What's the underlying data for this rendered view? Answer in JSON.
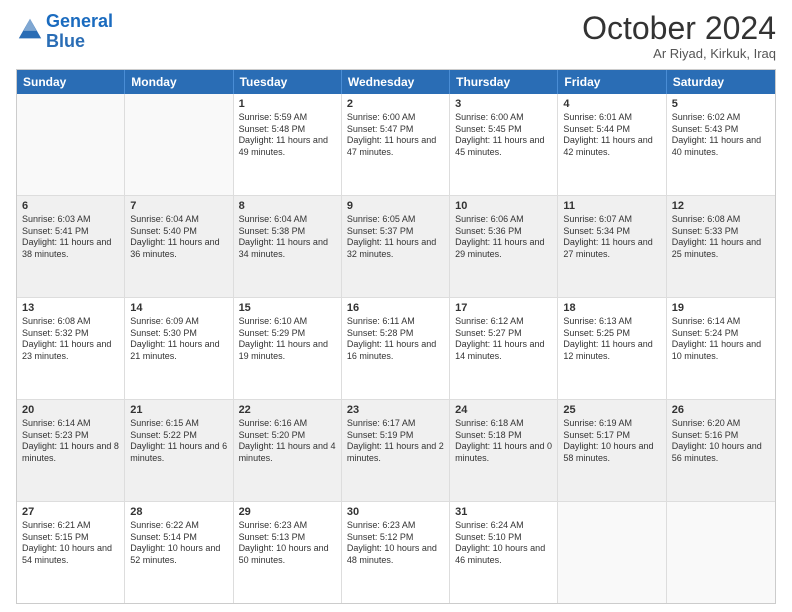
{
  "header": {
    "logo_general": "General",
    "logo_blue": "Blue",
    "month_year": "October 2024",
    "location": "Ar Riyad, Kirkuk, Iraq"
  },
  "days_of_week": [
    "Sunday",
    "Monday",
    "Tuesday",
    "Wednesday",
    "Thursday",
    "Friday",
    "Saturday"
  ],
  "weeks": [
    [
      {
        "day": "",
        "sunrise": "",
        "sunset": "",
        "daylight": "",
        "shaded": false
      },
      {
        "day": "",
        "sunrise": "",
        "sunset": "",
        "daylight": "",
        "shaded": false
      },
      {
        "day": "1",
        "sunrise": "Sunrise: 5:59 AM",
        "sunset": "Sunset: 5:48 PM",
        "daylight": "Daylight: 11 hours and 49 minutes.",
        "shaded": false
      },
      {
        "day": "2",
        "sunrise": "Sunrise: 6:00 AM",
        "sunset": "Sunset: 5:47 PM",
        "daylight": "Daylight: 11 hours and 47 minutes.",
        "shaded": false
      },
      {
        "day": "3",
        "sunrise": "Sunrise: 6:00 AM",
        "sunset": "Sunset: 5:45 PM",
        "daylight": "Daylight: 11 hours and 45 minutes.",
        "shaded": false
      },
      {
        "day": "4",
        "sunrise": "Sunrise: 6:01 AM",
        "sunset": "Sunset: 5:44 PM",
        "daylight": "Daylight: 11 hours and 42 minutes.",
        "shaded": false
      },
      {
        "day": "5",
        "sunrise": "Sunrise: 6:02 AM",
        "sunset": "Sunset: 5:43 PM",
        "daylight": "Daylight: 11 hours and 40 minutes.",
        "shaded": false
      }
    ],
    [
      {
        "day": "6",
        "sunrise": "Sunrise: 6:03 AM",
        "sunset": "Sunset: 5:41 PM",
        "daylight": "Daylight: 11 hours and 38 minutes.",
        "shaded": true
      },
      {
        "day": "7",
        "sunrise": "Sunrise: 6:04 AM",
        "sunset": "Sunset: 5:40 PM",
        "daylight": "Daylight: 11 hours and 36 minutes.",
        "shaded": true
      },
      {
        "day": "8",
        "sunrise": "Sunrise: 6:04 AM",
        "sunset": "Sunset: 5:38 PM",
        "daylight": "Daylight: 11 hours and 34 minutes.",
        "shaded": true
      },
      {
        "day": "9",
        "sunrise": "Sunrise: 6:05 AM",
        "sunset": "Sunset: 5:37 PM",
        "daylight": "Daylight: 11 hours and 32 minutes.",
        "shaded": true
      },
      {
        "day": "10",
        "sunrise": "Sunrise: 6:06 AM",
        "sunset": "Sunset: 5:36 PM",
        "daylight": "Daylight: 11 hours and 29 minutes.",
        "shaded": true
      },
      {
        "day": "11",
        "sunrise": "Sunrise: 6:07 AM",
        "sunset": "Sunset: 5:34 PM",
        "daylight": "Daylight: 11 hours and 27 minutes.",
        "shaded": true
      },
      {
        "day": "12",
        "sunrise": "Sunrise: 6:08 AM",
        "sunset": "Sunset: 5:33 PM",
        "daylight": "Daylight: 11 hours and 25 minutes.",
        "shaded": true
      }
    ],
    [
      {
        "day": "13",
        "sunrise": "Sunrise: 6:08 AM",
        "sunset": "Sunset: 5:32 PM",
        "daylight": "Daylight: 11 hours and 23 minutes.",
        "shaded": false
      },
      {
        "day": "14",
        "sunrise": "Sunrise: 6:09 AM",
        "sunset": "Sunset: 5:30 PM",
        "daylight": "Daylight: 11 hours and 21 minutes.",
        "shaded": false
      },
      {
        "day": "15",
        "sunrise": "Sunrise: 6:10 AM",
        "sunset": "Sunset: 5:29 PM",
        "daylight": "Daylight: 11 hours and 19 minutes.",
        "shaded": false
      },
      {
        "day": "16",
        "sunrise": "Sunrise: 6:11 AM",
        "sunset": "Sunset: 5:28 PM",
        "daylight": "Daylight: 11 hours and 16 minutes.",
        "shaded": false
      },
      {
        "day": "17",
        "sunrise": "Sunrise: 6:12 AM",
        "sunset": "Sunset: 5:27 PM",
        "daylight": "Daylight: 11 hours and 14 minutes.",
        "shaded": false
      },
      {
        "day": "18",
        "sunrise": "Sunrise: 6:13 AM",
        "sunset": "Sunset: 5:25 PM",
        "daylight": "Daylight: 11 hours and 12 minutes.",
        "shaded": false
      },
      {
        "day": "19",
        "sunrise": "Sunrise: 6:14 AM",
        "sunset": "Sunset: 5:24 PM",
        "daylight": "Daylight: 11 hours and 10 minutes.",
        "shaded": false
      }
    ],
    [
      {
        "day": "20",
        "sunrise": "Sunrise: 6:14 AM",
        "sunset": "Sunset: 5:23 PM",
        "daylight": "Daylight: 11 hours and 8 minutes.",
        "shaded": true
      },
      {
        "day": "21",
        "sunrise": "Sunrise: 6:15 AM",
        "sunset": "Sunset: 5:22 PM",
        "daylight": "Daylight: 11 hours and 6 minutes.",
        "shaded": true
      },
      {
        "day": "22",
        "sunrise": "Sunrise: 6:16 AM",
        "sunset": "Sunset: 5:20 PM",
        "daylight": "Daylight: 11 hours and 4 minutes.",
        "shaded": true
      },
      {
        "day": "23",
        "sunrise": "Sunrise: 6:17 AM",
        "sunset": "Sunset: 5:19 PM",
        "daylight": "Daylight: 11 hours and 2 minutes.",
        "shaded": true
      },
      {
        "day": "24",
        "sunrise": "Sunrise: 6:18 AM",
        "sunset": "Sunset: 5:18 PM",
        "daylight": "Daylight: 11 hours and 0 minutes.",
        "shaded": true
      },
      {
        "day": "25",
        "sunrise": "Sunrise: 6:19 AM",
        "sunset": "Sunset: 5:17 PM",
        "daylight": "Daylight: 10 hours and 58 minutes.",
        "shaded": true
      },
      {
        "day": "26",
        "sunrise": "Sunrise: 6:20 AM",
        "sunset": "Sunset: 5:16 PM",
        "daylight": "Daylight: 10 hours and 56 minutes.",
        "shaded": true
      }
    ],
    [
      {
        "day": "27",
        "sunrise": "Sunrise: 6:21 AM",
        "sunset": "Sunset: 5:15 PM",
        "daylight": "Daylight: 10 hours and 54 minutes.",
        "shaded": false
      },
      {
        "day": "28",
        "sunrise": "Sunrise: 6:22 AM",
        "sunset": "Sunset: 5:14 PM",
        "daylight": "Daylight: 10 hours and 52 minutes.",
        "shaded": false
      },
      {
        "day": "29",
        "sunrise": "Sunrise: 6:23 AM",
        "sunset": "Sunset: 5:13 PM",
        "daylight": "Daylight: 10 hours and 50 minutes.",
        "shaded": false
      },
      {
        "day": "30",
        "sunrise": "Sunrise: 6:23 AM",
        "sunset": "Sunset: 5:12 PM",
        "daylight": "Daylight: 10 hours and 48 minutes.",
        "shaded": false
      },
      {
        "day": "31",
        "sunrise": "Sunrise: 6:24 AM",
        "sunset": "Sunset: 5:10 PM",
        "daylight": "Daylight: 10 hours and 46 minutes.",
        "shaded": false
      },
      {
        "day": "",
        "sunrise": "",
        "sunset": "",
        "daylight": "",
        "shaded": false
      },
      {
        "day": "",
        "sunrise": "",
        "sunset": "",
        "daylight": "",
        "shaded": false
      }
    ]
  ]
}
